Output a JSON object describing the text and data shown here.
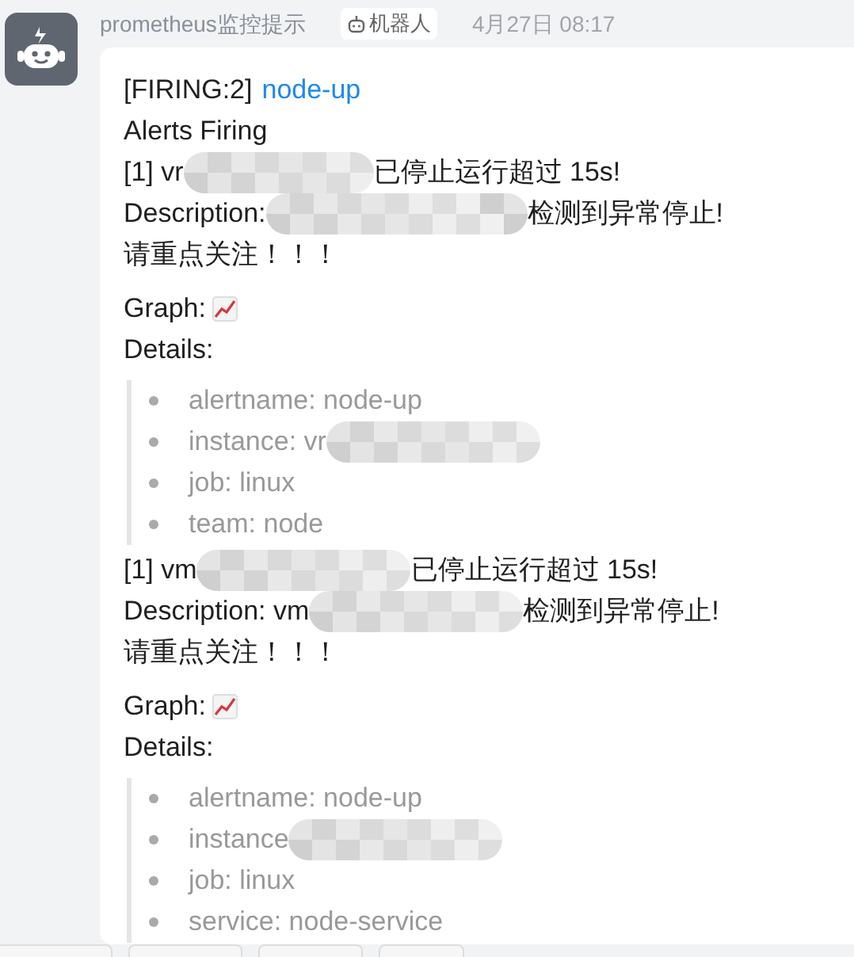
{
  "sender": {
    "name": "prometheus监控提示",
    "badge": "机器人",
    "time": "4月27日 08:17"
  },
  "message": {
    "title_prefix": "[FIRING:2]",
    "title_link": "node-up",
    "status": "Alerts Firing",
    "alerts": [
      {
        "summary": {
          "before": "[1] vr",
          "redacted": true,
          "after": "已停止运行超过 15s!"
        },
        "description": {
          "before": "Description:",
          "redacted": true,
          "after": "检测到异常停止!"
        },
        "notice": "请重点关注！！！",
        "graph_label": "Graph:",
        "details_label": "Details:",
        "details": [
          {
            "before": "alertname: node-up",
            "redacted": false
          },
          {
            "before": "instance: vr",
            "redacted": true
          },
          {
            "before": "job: linux",
            "redacted": false
          },
          {
            "before": "team: node",
            "redacted": false
          }
        ]
      },
      {
        "summary": {
          "before": "[1] vm",
          "redacted": true,
          "after": "已停止运行超过 15s!"
        },
        "description": {
          "before": "Description: vm",
          "redacted": true,
          "after": "检测到异常停止!"
        },
        "notice": "请重点关注！！！",
        "graph_label": "Graph:",
        "details_label": "Details:",
        "details": [
          {
            "before": "alertname: node-up",
            "redacted": false
          },
          {
            "before": "instance",
            "redacted": true
          },
          {
            "before": "job: linux",
            "redacted": false
          },
          {
            "before": "service: node-service",
            "redacted": false
          }
        ]
      }
    ]
  }
}
